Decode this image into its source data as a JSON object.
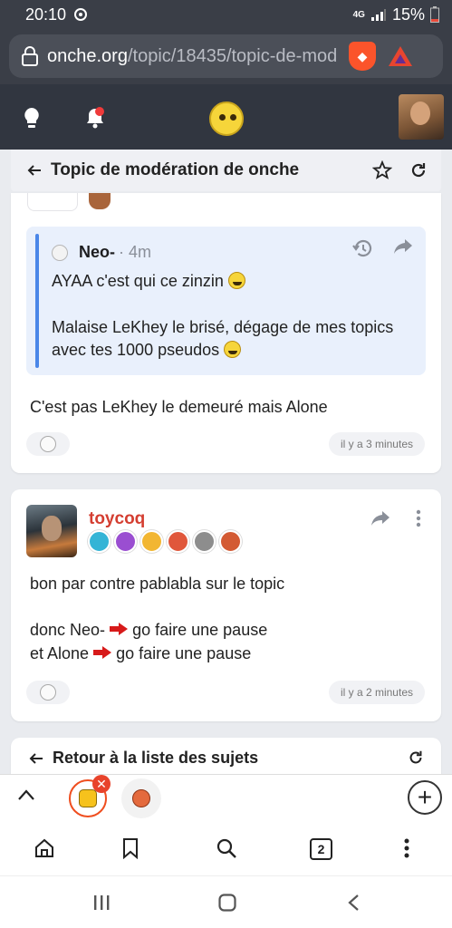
{
  "status_bar": {
    "time": "20:10",
    "network": "4G",
    "battery": "15%"
  },
  "browser": {
    "url_host": "onche.org",
    "url_path": "/topic/18435/topic-de-mod"
  },
  "topic": {
    "title": "Topic de modération de onche"
  },
  "post1": {
    "quote": {
      "author": "Neo-",
      "time": "· 4m",
      "line1": "AYAA c'est qui ce zinzin",
      "line2": "Malaise LeKhey le brisé, dégage de mes topics",
      "line3": "avec tes 1000 pseudos"
    },
    "text": "C'est pas LeKhey le demeuré mais Alone",
    "timestamp": "il y a 3 minutes"
  },
  "post2": {
    "author": "toycoq",
    "line1": "bon par contre pablabla sur le topic",
    "line2a": "donc Neo-",
    "line2b": "go faire une pause",
    "line3a": "et Alone",
    "line3b": "go faire une pause",
    "timestamp": "il y a 2 minutes",
    "badges": [
      {
        "icon": "star-badge-icon",
        "color": "#34b4d6"
      },
      {
        "icon": "dollar-badge-icon",
        "color": "#9a4ed1"
      },
      {
        "icon": "smiley-badge-icon",
        "color": "#f2b632"
      },
      {
        "icon": "sticker-badge-icon",
        "color": "#e0573b"
      },
      {
        "icon": "portrait-badge-icon",
        "color": "#8d8d8d"
      },
      {
        "icon": "face-badge-icon",
        "color": "#d35a33"
      }
    ]
  },
  "back_link": {
    "label": "Retour à la liste des sujets"
  },
  "tabs": {
    "count": "2"
  },
  "colors": {
    "header": "#313640",
    "author": "#d43e31",
    "quote_bar": "#4a86e8",
    "tab_accent": "#ef4e1f"
  }
}
